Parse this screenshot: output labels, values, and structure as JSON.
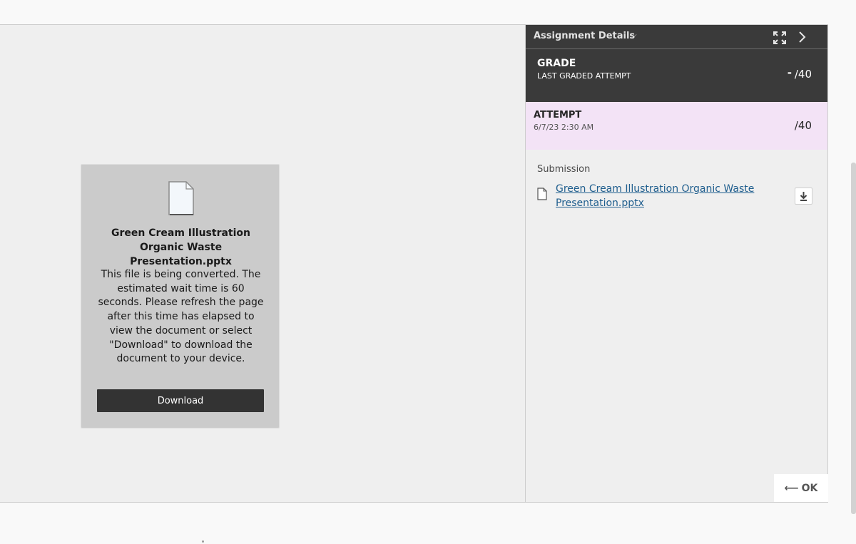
{
  "viewer": {
    "file_name": "Green Cream Illustration Organic Waste Presentation.pptx",
    "message": "This file is being converted. The estimated wait time is 60 seconds. Please refresh the page after this time has elapsed to view the document or select \"Download\" to download the document to your device.",
    "download_label": "Download"
  },
  "panel": {
    "title": "Assignment Details",
    "grade": {
      "label": "GRADE",
      "sublabel": "LAST GRADED ATTEMPT",
      "value": "-",
      "max": "/40"
    },
    "attempt": {
      "label": "ATTEMPT",
      "date": "6/7/23 2:30 AM",
      "max": "/40"
    },
    "submission_label": "Submission",
    "submission_file": "Green Cream Illustration Organic Waste Presentation.pptx",
    "ok_label": "OK"
  }
}
